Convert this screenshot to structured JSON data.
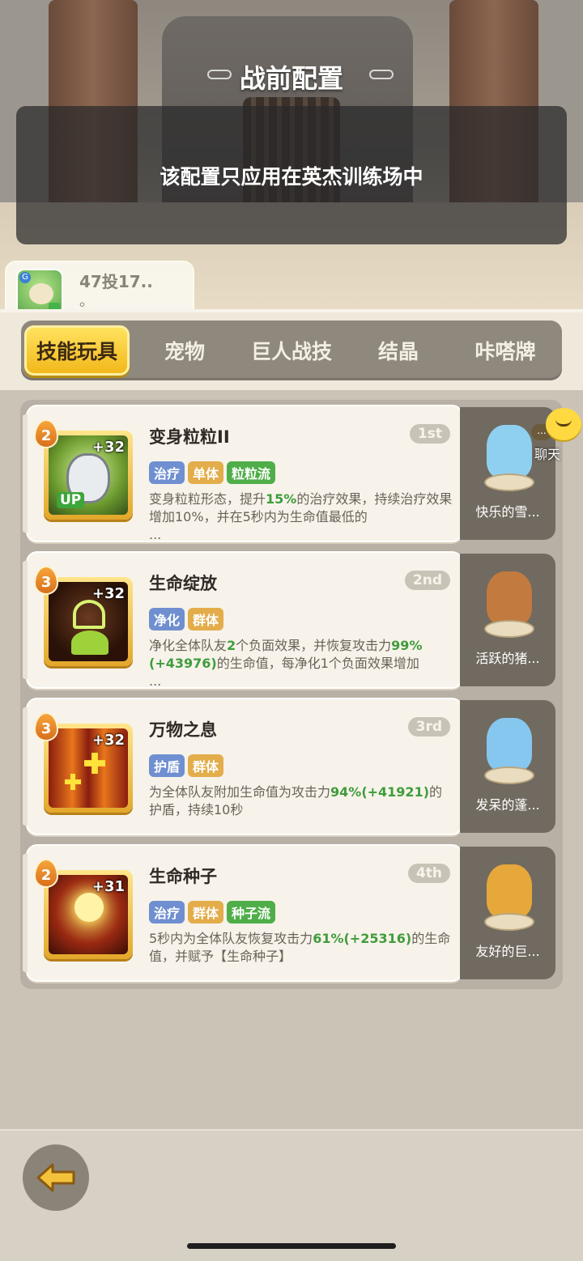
{
  "screen": {
    "title": "战前配置",
    "notice": "该配置只应用在英杰训练场中"
  },
  "player": {
    "name": "47投17..",
    "sub": "。"
  },
  "tabs": [
    {
      "label": "技能玩具",
      "active": true
    },
    {
      "label": "宠物",
      "active": false
    },
    {
      "label": "巨人战技",
      "active": false
    },
    {
      "label": "结晶",
      "active": false
    },
    {
      "label": "咔嗒牌",
      "active": false
    }
  ],
  "skills": [
    {
      "name": "变身粒粒II",
      "rank": "1st",
      "level": "2",
      "bonus": "+32",
      "up": "UP",
      "tags": [
        "治疗",
        "单体",
        "粒粒流"
      ],
      "desc_parts": [
        "变身粒粒形态，提升",
        "15%",
        "的治疗效果，持续治疗效果增加10%，并在5秒内为生命值最低的",
        "..."
      ]
    },
    {
      "name": "生命绽放",
      "rank": "2nd",
      "level": "3",
      "bonus": "+32",
      "tags": [
        "净化",
        "群体"
      ],
      "desc_parts": [
        "净化全体队友",
        "2",
        "个负面效果，并恢复攻击力",
        "99%(+43976)",
        "的生命值，每净化1个负面效果增加",
        "..."
      ]
    },
    {
      "name": "万物之息",
      "rank": "3rd",
      "level": "3",
      "bonus": "+32",
      "tags": [
        "护盾",
        "群体"
      ],
      "desc_parts": [
        "为全体队友附加生命值为攻击力",
        "94%(+41921)",
        "的护盾，持续10秒"
      ]
    },
    {
      "name": "生命种子",
      "rank": "4th",
      "level": "2",
      "bonus": "+31",
      "tags": [
        "治疗",
        "群体",
        "种子流"
      ],
      "desc_parts": [
        "5秒内为全体队友恢复攻击力",
        "61%(+25316)",
        "的生命值，并赋予【生命种子】"
      ]
    }
  ],
  "pets": [
    {
      "name": "快乐的雪...",
      "color": "#8fd0f0"
    },
    {
      "name": "活跃的猪...",
      "color": "#c27a3e"
    },
    {
      "name": "发呆的蓬...",
      "color": "#86c7ef"
    },
    {
      "name": "友好的巨...",
      "color": "#e6a83a"
    }
  ],
  "chat": {
    "label": "聊天",
    "dots": "..."
  },
  "colors": {
    "tab_active": "#f2b81b",
    "tag_blue": "#6f8fd0",
    "tag_orange": "#e3ad4b",
    "tag_green": "#4fae48",
    "highlight_green": "#3f9c3c"
  },
  "icons": {
    "back": "back-arrow-icon",
    "chat": "chat-bubble-icon"
  }
}
